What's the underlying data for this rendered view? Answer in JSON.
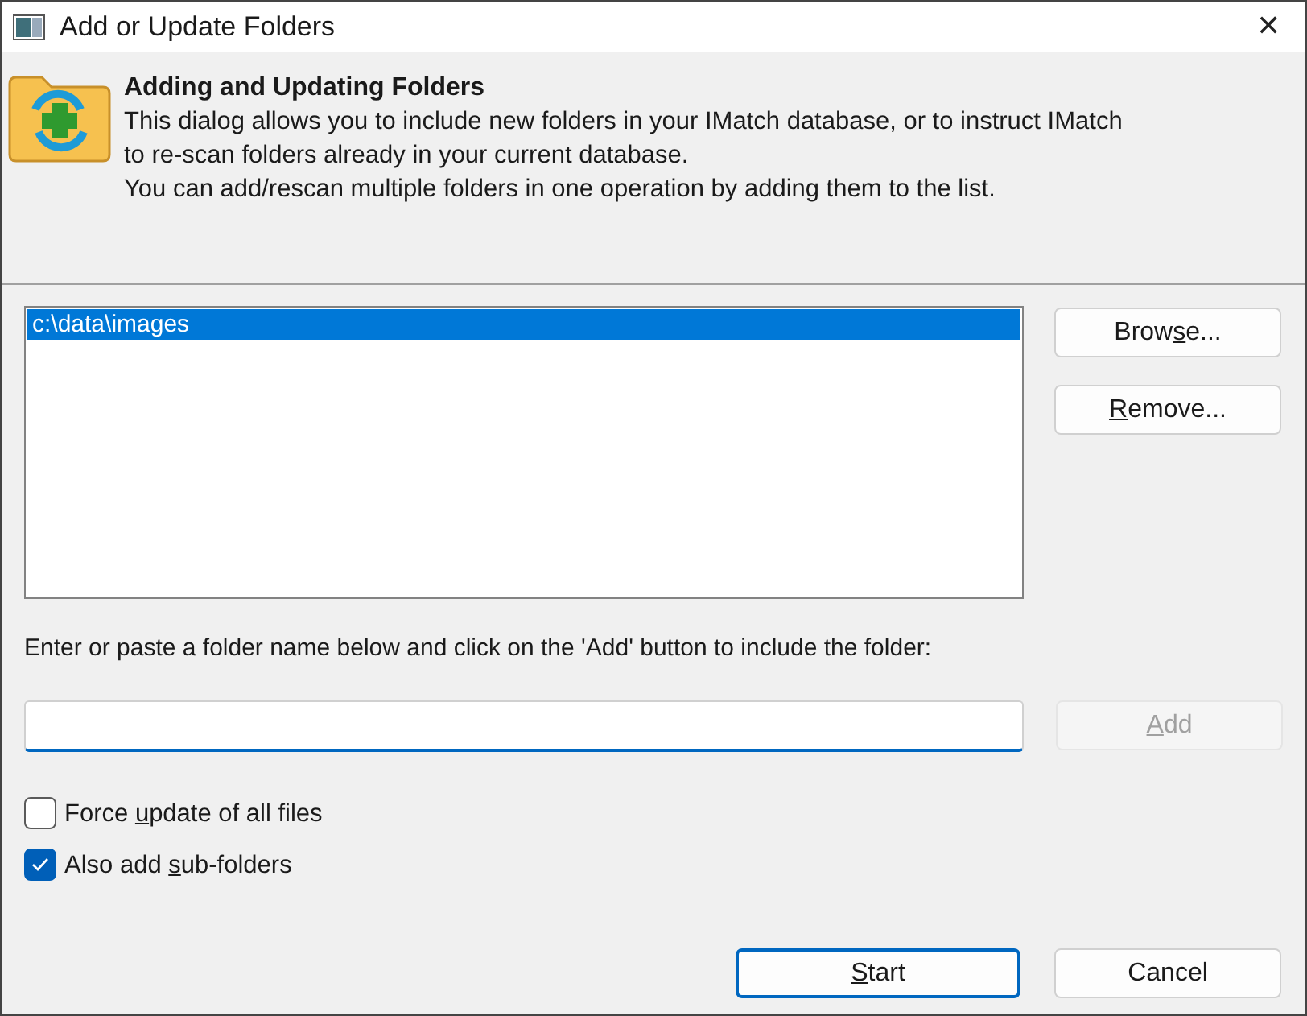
{
  "window": {
    "title": "Add or Update Folders",
    "close": "✕"
  },
  "header": {
    "title": "Adding and Updating Folders",
    "lines": [
      "This dialog allows you to include new folders in your IMatch database, or to instruct IMatch",
      "to re-scan folders already in your current database.",
      "You can add/rescan multiple folders in one operation by adding them to the list."
    ]
  },
  "folder_list": {
    "items": [
      {
        "text": "c:\\data\\images",
        "selected": true
      }
    ]
  },
  "side_buttons": [
    {
      "label": [
        {
          "text": "Brow",
          "underlined": false
        },
        {
          "text": "s",
          "underlined": true
        },
        {
          "text": "e...",
          "underlined": false
        }
      ],
      "disabled": false
    },
    {
      "label": [
        {
          "text": "R",
          "underlined": true
        },
        {
          "text": "emove...",
          "underlined": false
        }
      ],
      "disabled": false
    }
  ],
  "instruction": "Enter or paste a folder name below and click on the 'Add' button to include the folder:",
  "folder_input": {
    "focused": true
  },
  "add_button": {
    "label": [
      {
        "text": "A",
        "underlined": true
      },
      {
        "text": "dd",
        "underlined": false
      }
    ],
    "disabled": true
  },
  "options": [
    {
      "label": [
        {
          "text": "Force ",
          "underlined": false
        },
        {
          "text": "u",
          "underlined": true
        },
        {
          "text": "pdate of all files",
          "underlined": false
        }
      ],
      "checked": false
    },
    {
      "label": [
        {
          "text": "Also add ",
          "underlined": false
        },
        {
          "text": "s",
          "underlined": true
        },
        {
          "text": "ub-folders",
          "underlined": false
        }
      ],
      "checked": true
    }
  ],
  "footer_buttons": [
    {
      "label": [
        {
          "text": "S",
          "underlined": true
        },
        {
          "text": "tart",
          "underlined": false
        }
      ],
      "default": true
    },
    {
      "label": [
        {
          "text": "Cancel",
          "underlined": false
        }
      ],
      "default": false
    }
  ]
}
